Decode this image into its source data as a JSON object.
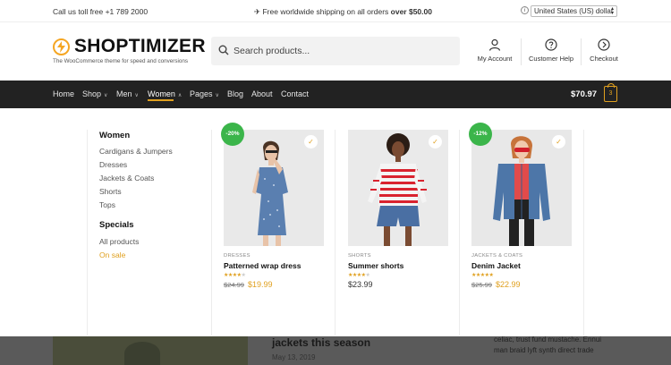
{
  "topbar": {
    "call_text": "Call us toll free +1 789 2000",
    "shipping_prefix": "✈ Free worldwide shipping on all orders",
    "shipping_amount": "over $50.00",
    "info_icon": "i",
    "currency": "United States (US) dollar"
  },
  "header": {
    "logo_text": "SHOPTIMIZER",
    "tagline": "The WooCommerce theme for speed and conversions",
    "search_placeholder": "Search products...",
    "links": [
      {
        "label": "My Account",
        "icon": "user-icon"
      },
      {
        "label": "Customer Help",
        "icon": "help-icon"
      },
      {
        "label": "Checkout",
        "icon": "arrow-right-circle-icon"
      }
    ]
  },
  "nav": {
    "items": [
      {
        "label": "Home"
      },
      {
        "label": "Shop"
      },
      {
        "label": "Men"
      },
      {
        "label": "Women"
      },
      {
        "label": "Pages"
      },
      {
        "label": "Blog"
      },
      {
        "label": "About"
      },
      {
        "label": "Contact"
      }
    ],
    "cart_total": "$70.97",
    "cart_count": "3",
    "accent": "#e0a01f"
  },
  "mega_menu": {
    "women_heading": "Women",
    "women_links": [
      "Cardigans & Jumpers",
      "Dresses",
      "Jackets & Coats",
      "Shorts",
      "Tops"
    ],
    "specials_heading": "Specials",
    "specials_links": [
      "All products",
      "On sale"
    ],
    "products": [
      {
        "badge": "-20%",
        "category": "DRESSES",
        "name": "Patterned wrap dress",
        "rating": 4,
        "old_price": "$24.99",
        "price": "$19.99"
      },
      {
        "badge": "",
        "category": "SHORTS",
        "name": "Summer shorts",
        "rating": 4,
        "old_price": "",
        "price": "$23.99"
      },
      {
        "badge": "-12%",
        "category": "JACKETS & COATS",
        "name": "Denim Jacket",
        "rating": 5,
        "old_price": "$25.99",
        "price": "$22.99"
      }
    ],
    "badge_color": "#3bb54a"
  },
  "below": {
    "post_title": "jackets this season",
    "post_date": "May 13, 2019",
    "excerpt": "celiac, trust fund mustache. Ennui man braid lyft synth direct trade"
  }
}
